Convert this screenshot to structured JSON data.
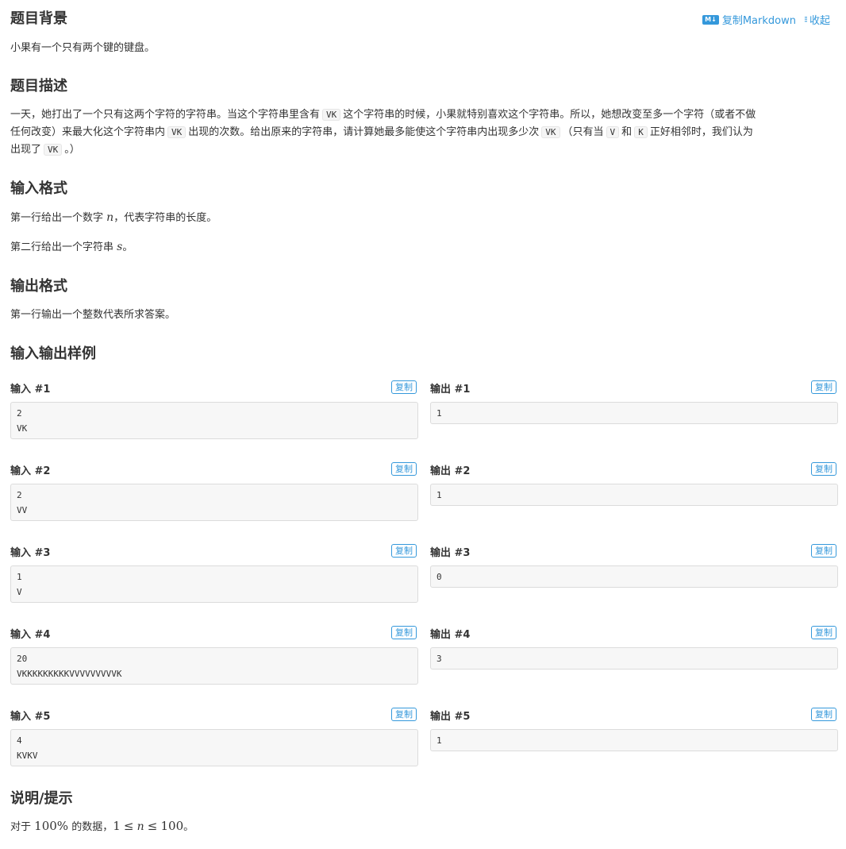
{
  "actions": {
    "copy_markdown_icon": "M↓",
    "copy_markdown": "复制Markdown",
    "collapse": "收起"
  },
  "background": {
    "title": "题目背景",
    "text": "小果有一个只有两个键的键盘。"
  },
  "description": {
    "title": "题目描述",
    "line1_a": "一天，她打出了一个只有这两个字符的字符串。当这个字符串里含有",
    "code_vk": "VK",
    "line1_b": "这个字符串的时候，小果就特别喜欢这个字符串。所以，她想改变至多一个字符（或者不做",
    "line2_a": "任何改变）来最大化这个字符串内",
    "line2_b": "出现的次数。给出原来的字符串，请计算她最多能使这个字符串内出现多少次",
    "line2_c": "（只有当",
    "code_v": "V",
    "line2_d": "和",
    "code_k": "K",
    "line2_e": "正好相邻时，我们认为",
    "line3_a": "出现了",
    "line3_b": "。）"
  },
  "input_format": {
    "title": "输入格式",
    "line1_a": "第一行给出一个数字",
    "var_n": "n",
    "line1_b": "，代表字符串的长度。",
    "line2_a": "第二行给出一个字符串",
    "var_s": "s",
    "line2_b": "。"
  },
  "output_format": {
    "title": "输出格式",
    "text": "第一行输出一个整数代表所求答案。"
  },
  "samples": {
    "title": "输入输出样例",
    "copy_label": "复制",
    "items": [
      {
        "in_label": "输入 #1",
        "out_label": "输出 #1",
        "input": "2\nVK",
        "output": "1"
      },
      {
        "in_label": "输入 #2",
        "out_label": "输出 #2",
        "input": "2\nVV",
        "output": "1"
      },
      {
        "in_label": "输入 #3",
        "out_label": "输出 #3",
        "input": "1\nV",
        "output": "0"
      },
      {
        "in_label": "输入 #4",
        "out_label": "输出 #4",
        "input": "20\nVKKKKKKKKKVVVVVVVVVK",
        "output": "3"
      },
      {
        "in_label": "输入 #5",
        "out_label": "输出 #5",
        "input": "4\nKVKV",
        "output": "1"
      }
    ]
  },
  "hint": {
    "title": "说明/提示",
    "text_a": "对于",
    "pct": "100%",
    "text_b": "的数据，",
    "math_lower": "1",
    "leq": "≤",
    "var_n": "n",
    "math_upper": "100",
    "text_c": "。"
  }
}
